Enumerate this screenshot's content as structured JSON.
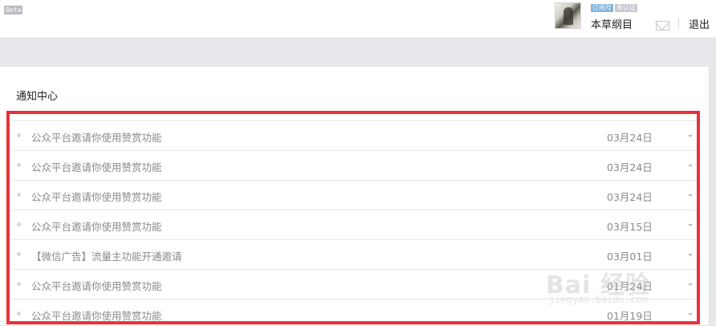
{
  "header": {
    "beta_label": "Beta",
    "badge_subscription": "订阅号",
    "badge_unverified": "未认证",
    "account_name": "本草纲目",
    "mail_icon": "mail-icon",
    "logout_label": "退出"
  },
  "panel": {
    "title": "通知中心"
  },
  "notifications": [
    {
      "title": "公众平台邀请你使用赞赏功能",
      "date": "03月24日"
    },
    {
      "title": "公众平台邀请你使用赞赏功能",
      "date": "03月24日"
    },
    {
      "title": "公众平台邀请你使用赞赏功能",
      "date": "03月24日"
    },
    {
      "title": "公众平台邀请你使用赞赏功能",
      "date": "03月15日"
    },
    {
      "title": "【微信广告】流量主功能开通邀请",
      "date": "03月01日"
    },
    {
      "title": "公众平台邀请你使用赞赏功能",
      "date": "01月24日"
    },
    {
      "title": "公众平台邀请你使用赞赏功能",
      "date": "01月19日"
    }
  ],
  "annotation": {
    "highlight_color": "#e8323a"
  },
  "watermark": {
    "main": "Bai 经验",
    "sub": "jingyan.baidu.com"
  }
}
